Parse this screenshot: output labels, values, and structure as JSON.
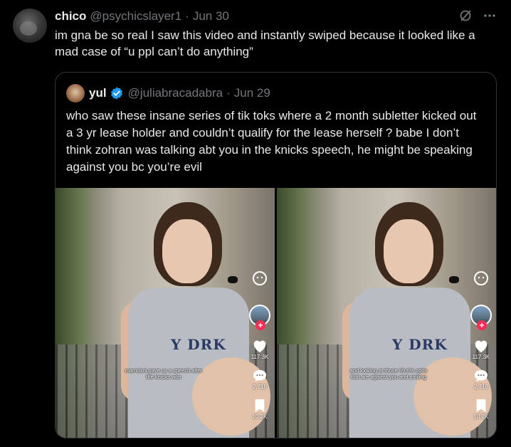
{
  "tweet": {
    "name": "chico",
    "handle": "@psychicslayer1",
    "dot": "·",
    "date": "Jun 30",
    "text": "im gna be so real I saw this video and instantly swiped because it looked like a mad case of “u ppl can’t do anything”"
  },
  "quote": {
    "name": "yul",
    "handle": "@juliabracadabra",
    "dot": "·",
    "date": "Jun 29",
    "text": "who saw these insane series of tik toks where a 2 month subletter kicked out a 3 yr lease holder and couldn’t qualify for the lease herself ? babe I don’t think zohran was talking abt you in the knicks speech, he might be speaking against you bc you’re evil"
  },
  "videos": [
    {
      "caption": "mamdani gave us a speech after the knicks won",
      "shirt_text": "Y DRK",
      "plus": "+",
      "likes": "117.3K",
      "comments": "2,716",
      "saves": "10.2K"
    },
    {
      "caption": "and looking at those 99.6% odds that are against you and smiling",
      "shirt_text": "Y DRK",
      "plus": "+",
      "likes": "117.3K",
      "comments": "2,716",
      "saves": "10.2K"
    }
  ],
  "icons": {
    "grok": "grok-icon",
    "more": "more-icon",
    "verified": "verified-badge-icon",
    "tiktok_effect": "face-effect-icon",
    "like": "heart-icon",
    "comment": "comment-icon",
    "save": "bookmark-icon"
  },
  "colors": {
    "background": "#000000",
    "text_primary": "#e7e9ea",
    "text_muted": "#71767b",
    "border": "#2f3336",
    "verified_blue": "#1d9bf0",
    "tiktok_red": "#fe2c55"
  }
}
